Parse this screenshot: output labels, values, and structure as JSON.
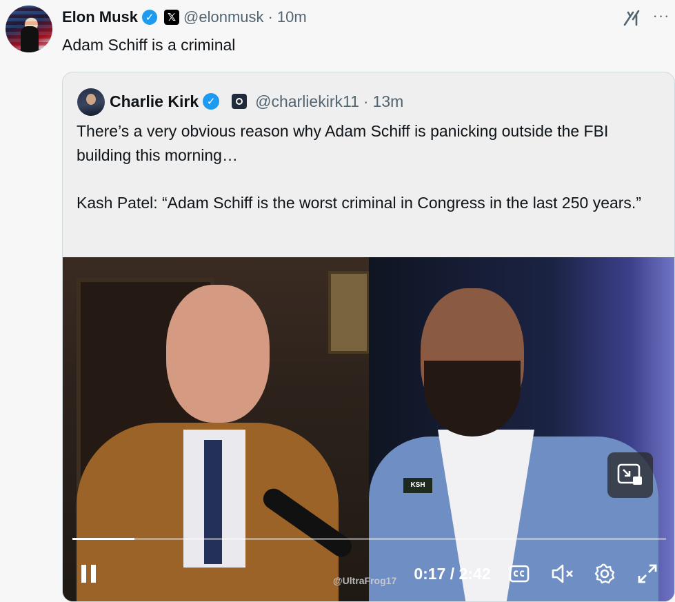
{
  "post": {
    "author_name": "Elon Musk",
    "handle": "@elonmusk",
    "separator": "·",
    "time": "10m",
    "text": "Adam Schiff is a criminal",
    "more_label": "···"
  },
  "quote": {
    "author_name": "Charlie Kirk",
    "handle": "@charliekirk11",
    "separator": "·",
    "time": "13m",
    "text_line1": "There’s a very obvious reason why Adam Schiff is panicking outside the FBI building this morning…",
    "text_line2": "Kash Patel: “Adam Schiff is the worst criminal in Congress in the last 250 years.”"
  },
  "video": {
    "current_time": "0:17",
    "duration": "2:42",
    "time_separator": " / ",
    "progress_fraction": 0.105,
    "watermark": "@UltraFrog17",
    "pin_text": "KSH"
  },
  "icons": {
    "verified": "verified-badge-icon",
    "x_logo": "x-logo-icon",
    "grok": "grok-icon",
    "more": "more-icon",
    "play_pause": "pause-icon",
    "captions": "captions-icon",
    "mute": "muted-icon",
    "settings": "gear-icon",
    "fullscreen": "fullscreen-icon",
    "pip": "picture-in-picture-icon"
  },
  "colors": {
    "accent": "#1d9bf0",
    "text": "#0f1419",
    "secondary": "#536471",
    "background": "#f7f7f7"
  }
}
